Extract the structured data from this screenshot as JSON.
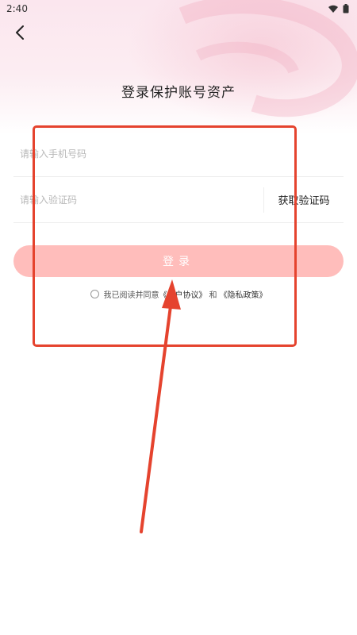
{
  "status_bar": {
    "time": "2:40",
    "icons": [
      "wifi-icon",
      "battery-icon"
    ]
  },
  "header": {
    "back_icon": "chevron-left-icon",
    "title": "登录保护账号资产"
  },
  "form": {
    "phone_placeholder": "请输入手机号码",
    "phone_value": "",
    "code_placeholder": "请输入验证码",
    "code_value": "",
    "get_code_label": "获取验证码",
    "login_label": "登录"
  },
  "agreement": {
    "prefix": "我已阅读并同意",
    "user_agreement": "《用户协议》",
    "connector": "和",
    "privacy_policy": "《隐私政策》",
    "checked": false
  },
  "colors": {
    "accent": "#ffbdbb",
    "annotation": "#e5432e",
    "hero_tint": "#fbe6ee"
  }
}
